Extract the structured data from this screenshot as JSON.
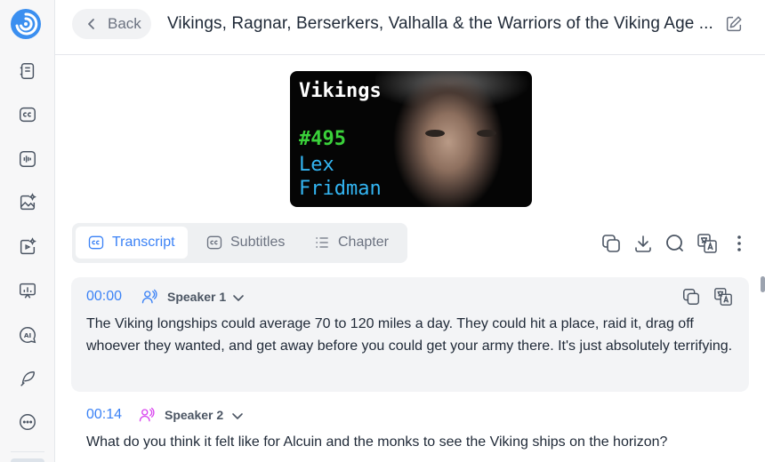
{
  "sidebar": {
    "items": [
      {
        "icon": "notebook-icon"
      },
      {
        "icon": "captions-icon"
      },
      {
        "icon": "audio-wave-icon"
      },
      {
        "icon": "image-sparkle-icon"
      },
      {
        "icon": "video-sparkle-icon"
      },
      {
        "icon": "presentation-chart-icon"
      },
      {
        "icon": "ai-chat-icon"
      },
      {
        "icon": "pen-feather-icon"
      },
      {
        "icon": "more-icon"
      }
    ]
  },
  "header": {
    "back_label": "Back",
    "title": "Vikings, Ragnar, Berserkers, Valhalla & the Warriors of the Viking Age ..."
  },
  "thumbnail": {
    "title": "Vikings",
    "episode": "#495",
    "host_first": "Lex",
    "host_last": "Fridman"
  },
  "tabs": [
    {
      "label": "Transcript",
      "active": true
    },
    {
      "label": "Subtitles",
      "active": false
    },
    {
      "label": "Chapter",
      "active": false
    }
  ],
  "segments": [
    {
      "time": "00:00",
      "speaker": "Speaker 1",
      "text": "The Viking longships could average 70 to 120 miles a day. They could hit a place, raid it, drag off whoever they wanted, and get away before you could get your army there. It's just absolutely terrifying."
    },
    {
      "time": "00:14",
      "speaker": "Speaker 2",
      "text": "What do you think it felt like for Alcuin and the monks to see the Viking ships on the horizon?"
    }
  ],
  "colors": {
    "accent": "#3b82f6",
    "speaker1": "#3b82f6",
    "speaker2": "#d946ef",
    "episode_green": "#3ad13a",
    "name_blue": "#33b5f2"
  }
}
